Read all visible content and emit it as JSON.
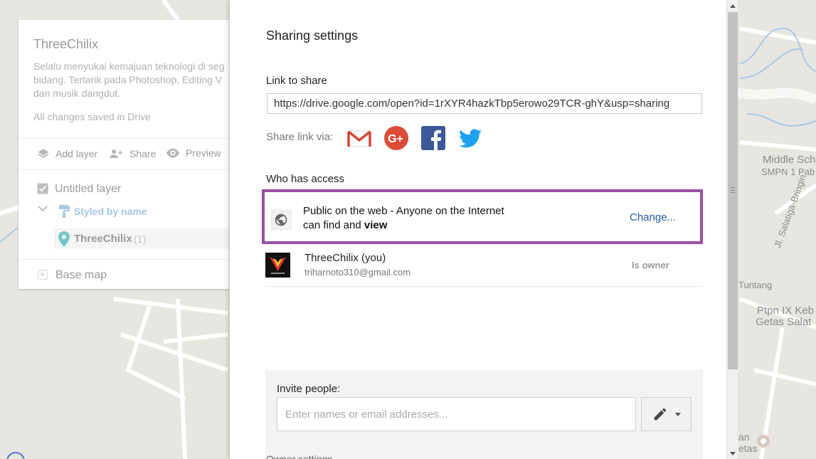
{
  "map": {
    "labels": [
      "Middle Sch",
      "SMPN 1 Pab",
      "Tuntang",
      "Ptpn IX Keb",
      "Getas Salat",
      "Jl. Salatiga-Bringin",
      "an",
      "etas"
    ]
  },
  "left_panel": {
    "title": "ThreeChilix",
    "description": "Selalu menyukai kemajuan teknologi di seg\nbidang. Tertarik pada Photoshop, Editing V\ndan musik dangdut.",
    "saved_status": "All changes saved in Drive",
    "toolbar": {
      "add_layer": "Add layer",
      "share": "Share",
      "preview": "Preview"
    },
    "layer": {
      "name": "Untitled layer",
      "checked": true,
      "style": "Styled by name",
      "feature_name": "ThreeChilix",
      "feature_count": "(1)"
    },
    "base_map": "Base map"
  },
  "dialog": {
    "title": "Sharing settings",
    "link_heading": "Link to share",
    "link_url": "https://drive.google.com/open?id=1rXYR4hazkTbp5erowo29TCR-ghY&usp=sharing",
    "share_via_label": "Share link via:",
    "share_icons": [
      "gmail-icon",
      "google-plus-icon",
      "facebook-icon",
      "twitter-icon"
    ],
    "who_has_access": "Who has access",
    "access": {
      "line1": "Public on the web - Anyone on the Internet",
      "line2_prefix": "can find and ",
      "line2_bold": "view",
      "change_link": "Change..."
    },
    "owner": {
      "name": "ThreeChilix (you)",
      "email": "triharnoto310@gmail.com",
      "role": "Is owner"
    },
    "invite": {
      "label": "Invite people:",
      "placeholder": "Enter names or email addresses..."
    },
    "cut_text": "Owner settings"
  },
  "colors": {
    "highlight_border": "#9b4fa4",
    "link_blue": "#1f5aa8",
    "gmail_red": "#d44638",
    "gplus_red": "#dd4b39",
    "facebook_blue": "#3b5998",
    "twitter_blue": "#1da1f2"
  }
}
